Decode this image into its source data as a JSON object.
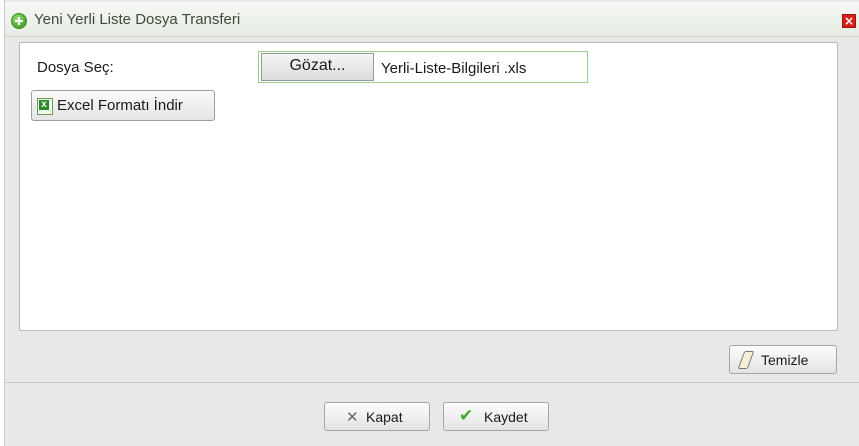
{
  "dialog": {
    "title": "Yeni Yerli Liste Dosya Transferi",
    "close_symbol": "×",
    "title_icon": "add-circle-icon"
  },
  "form": {
    "file_label": "Dosya Seç:",
    "browse_label": "Gözat...",
    "file_name": "Yerli-Liste-Bilgileri .xls",
    "excel_button_label": "Excel Formatı İndir",
    "excel_icon": "excel-file-icon"
  },
  "actions": {
    "clear_label": "Temizle",
    "clear_icon": "eraser-icon",
    "close_label": "Kapat",
    "close_icon": "x-icon",
    "save_label": "Kaydet",
    "save_icon": "check-icon"
  },
  "colors": {
    "close_button": "#d6211a",
    "title_icon_green": "#47a52c",
    "save_check_green": "#3fa82a"
  }
}
